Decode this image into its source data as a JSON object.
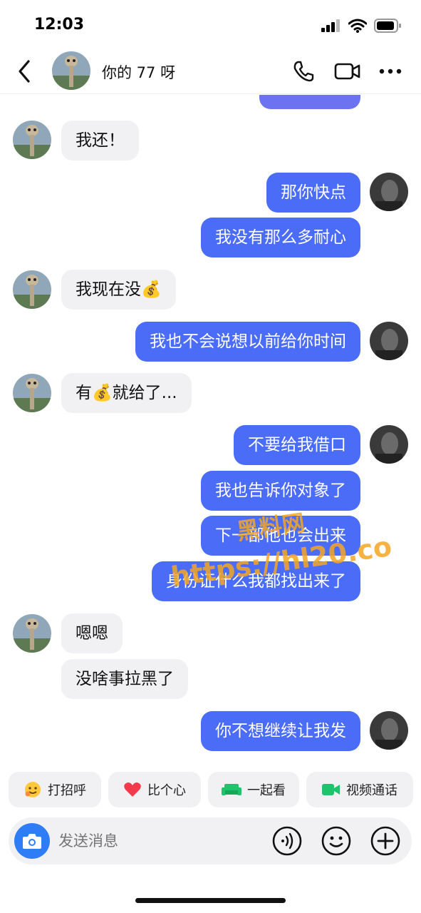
{
  "status_bar": {
    "time": "12:03"
  },
  "header": {
    "title": "你的 77 呀"
  },
  "messages": [
    {
      "side": "in",
      "text": "我还！"
    },
    {
      "side": "out",
      "text": "那你快点"
    },
    {
      "side": "out",
      "text": "我没有那么多耐心"
    },
    {
      "side": "in",
      "text": "我现在没💰"
    },
    {
      "side": "out",
      "text": "我也不会说想以前给你时间"
    },
    {
      "side": "in",
      "text": "有💰就给了..."
    },
    {
      "side": "out",
      "text": "不要给我借口"
    },
    {
      "side": "out",
      "text": "我也告诉你对象了"
    },
    {
      "side": "out",
      "text": "下一部他也会出来"
    },
    {
      "side": "out",
      "text": "身份证什么我都找出来了"
    },
    {
      "side": "in",
      "text": "嗯嗯"
    },
    {
      "side": "in",
      "text": "没啥事拉黑了"
    },
    {
      "side": "out",
      "text": "你不想继续让我发"
    }
  ],
  "watermark": {
    "line1": "黑料网",
    "line2": "https://hl20.co"
  },
  "quick_actions": [
    {
      "label": "打招呼",
      "icon": "wave-emoji-icon"
    },
    {
      "label": "比个心",
      "icon": "heart-icon"
    },
    {
      "label": "一起看",
      "icon": "sofa-icon"
    },
    {
      "label": "视频通话",
      "icon": "video-call-icon"
    }
  ],
  "input": {
    "placeholder": "发送消息"
  },
  "colors": {
    "outgoing_bubble": "#4a6cf7",
    "incoming_bubble": "#f1f1f3",
    "camera_button": "#2e7cf6",
    "watermark": "#f5a623"
  }
}
